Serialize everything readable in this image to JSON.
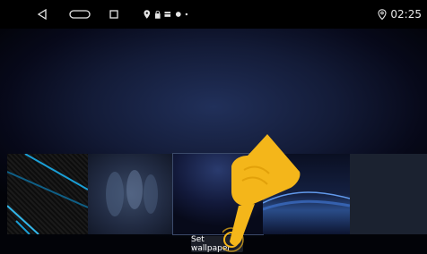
{
  "status_bar": {
    "time": "02:25",
    "nav_icons": [
      "back-icon",
      "home-icon",
      "recents-icon"
    ],
    "notification_icons": [
      "location-icon",
      "lock-icon",
      "card-icon",
      "circle-icon",
      "dot-icon"
    ],
    "status_icon": "location-icon"
  },
  "wallpaper_picker": {
    "thumbnails": [
      {
        "name": "carbon-blue-lines"
      },
      {
        "name": "blurred-figures"
      },
      {
        "name": "dark-blue-gradient"
      },
      {
        "name": "blue-wave"
      },
      {
        "name": "dark-slate"
      }
    ],
    "set_wallpaper_label": "Set wallpaper"
  }
}
